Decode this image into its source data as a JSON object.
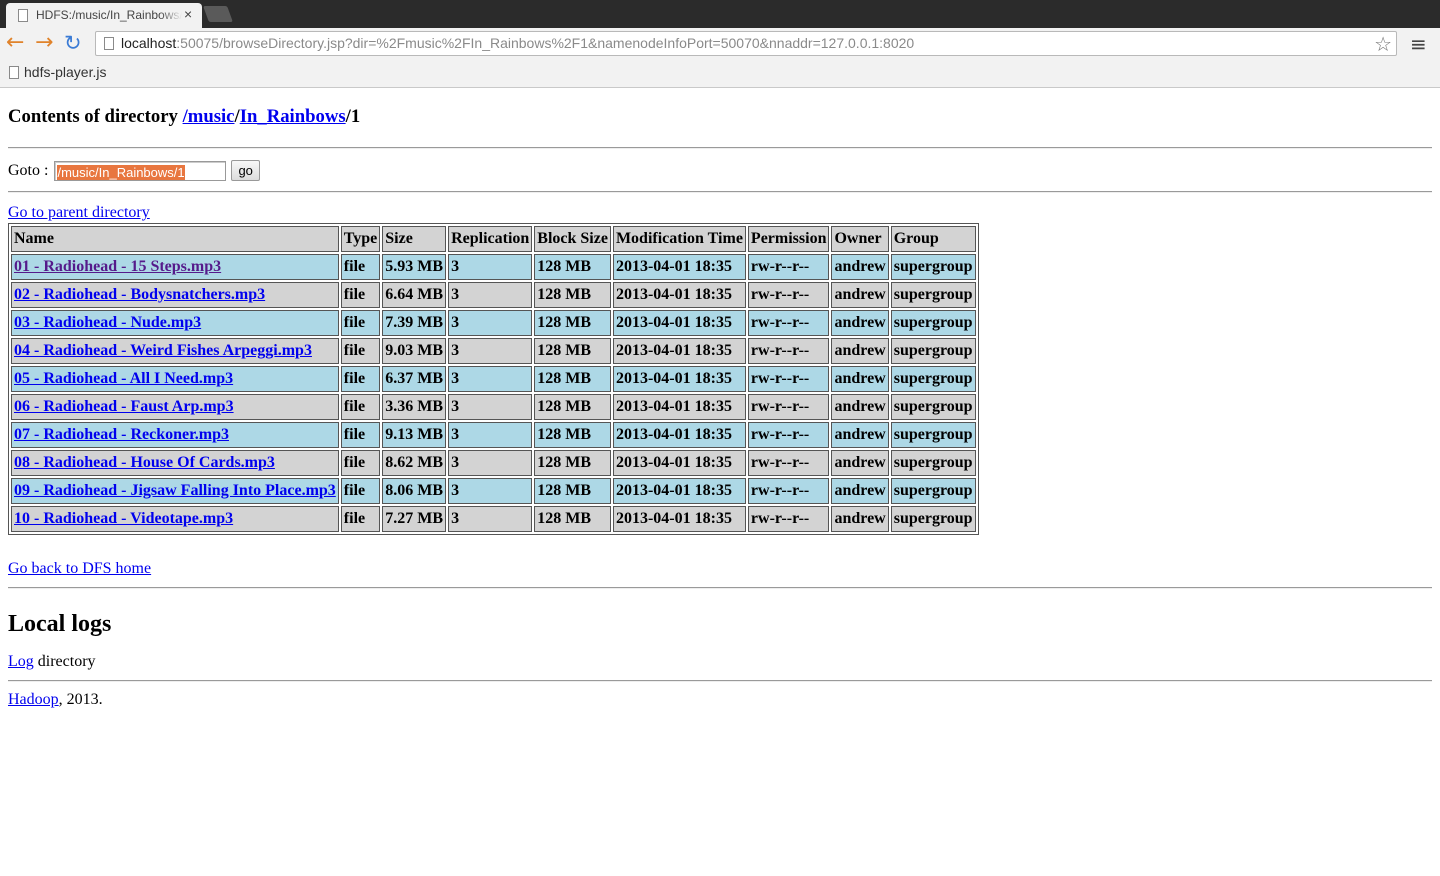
{
  "browser": {
    "tab_title": "HDFS:/music/In_Rainbows/1",
    "tab_close": "×",
    "url_host": "localhost",
    "url_rest": ":50075/browseDirectory.jsp?dir=%2Fmusic%2FIn_Rainbows%2F1&namenodeInfoPort=50070&nnaddr=127.0.0.1:8020",
    "bookmark_label": "hdfs-player.js",
    "back_icon": "←",
    "forward_icon": "→",
    "reload_icon": "↻",
    "star_icon": "☆",
    "menu_icon": "≡"
  },
  "page": {
    "heading_prefix": "Contents of directory ",
    "heading_link_music": "/music",
    "heading_sep": "/",
    "heading_link_rainbows": "In_Rainbows",
    "heading_suffix": "/1",
    "goto_label": "Goto : ",
    "goto_value": "/music/In_Rainbows/1",
    "go_button": "go",
    "parent_link": "Go to parent directory",
    "home_link": "Go back to DFS home",
    "logs_heading": "Local logs",
    "log_link": "Log",
    "log_suffix": " directory",
    "footer_link": "Hadoop",
    "footer_suffix": ", 2013."
  },
  "table": {
    "headers": [
      "Name",
      "Type",
      "Size",
      "Replication",
      "Block Size",
      "Modification Time",
      "Permission",
      "Owner",
      "Group"
    ],
    "rows": [
      [
        "01 - Radiohead - 15 Steps.mp3",
        "file",
        "5.93 MB",
        "3",
        "128 MB",
        "2013-04-01 18:35",
        "rw-r--r--",
        "andrew",
        "supergroup"
      ],
      [
        "02 - Radiohead - Bodysnatchers.mp3",
        "file",
        "6.64 MB",
        "3",
        "128 MB",
        "2013-04-01 18:35",
        "rw-r--r--",
        "andrew",
        "supergroup"
      ],
      [
        "03 - Radiohead - Nude.mp3",
        "file",
        "7.39 MB",
        "3",
        "128 MB",
        "2013-04-01 18:35",
        "rw-r--r--",
        "andrew",
        "supergroup"
      ],
      [
        "04 - Radiohead - Weird Fishes Arpeggi.mp3",
        "file",
        "9.03 MB",
        "3",
        "128 MB",
        "2013-04-01 18:35",
        "rw-r--r--",
        "andrew",
        "supergroup"
      ],
      [
        "05 - Radiohead - All I Need.mp3",
        "file",
        "6.37 MB",
        "3",
        "128 MB",
        "2013-04-01 18:35",
        "rw-r--r--",
        "andrew",
        "supergroup"
      ],
      [
        "06 - Radiohead - Faust Arp.mp3",
        "file",
        "3.36 MB",
        "3",
        "128 MB",
        "2013-04-01 18:35",
        "rw-r--r--",
        "andrew",
        "supergroup"
      ],
      [
        "07 - Radiohead - Reckoner.mp3",
        "file",
        "9.13 MB",
        "3",
        "128 MB",
        "2013-04-01 18:35",
        "rw-r--r--",
        "andrew",
        "supergroup"
      ],
      [
        "08 - Radiohead - House Of Cards.mp3",
        "file",
        "8.62 MB",
        "3",
        "128 MB",
        "2013-04-01 18:35",
        "rw-r--r--",
        "andrew",
        "supergroup"
      ],
      [
        "09 - Radiohead - Jigsaw Falling Into Place.mp3",
        "file",
        "8.06 MB",
        "3",
        "128 MB",
        "2013-04-01 18:35",
        "rw-r--r--",
        "andrew",
        "supergroup"
      ],
      [
        "10 - Radiohead - Videotape.mp3",
        "file",
        "7.27 MB",
        "3",
        "128 MB",
        "2013-04-01 18:35",
        "rw-r--r--",
        "andrew",
        "supergroup"
      ]
    ]
  },
  "colors": {
    "row_blue": "#add8e6",
    "row_gray": "#d3d3d3",
    "link": "#0000ee",
    "visited_link": "#551a8b",
    "selection": "#e8763f"
  }
}
